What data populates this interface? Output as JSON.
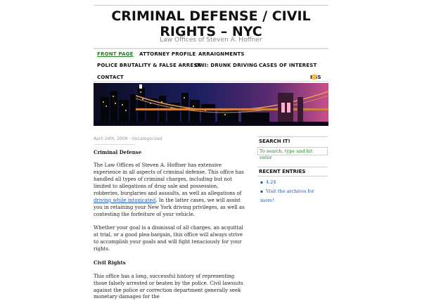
{
  "site": {
    "title": "CRIMINAL DEFENSE / CIVIL RIGHTS – NYC",
    "tagline": "Law Offices of Steven A. Hoffner"
  },
  "nav": {
    "items": [
      "FRONT PAGE",
      "ATTORNEY PROFILE",
      "ARRAIGNMENTS",
      "POLICE BRUTALITY & FALSE ARREST",
      "DWI: DRUNK DRIVING",
      "CASES OF INTEREST",
      "CONTACT"
    ],
    "rss": "RSS"
  },
  "post": {
    "meta": "April 24th, 2009 · Uncategorized",
    "heading1": "Criminal Defense",
    "p1_a": "The Law Offices of Steven A. Hoffner has extensive experience in all aspects of criminal defense. This office has handled all types of criminal charges, including but not limited to allegations of drug sale and possession, robberies, burglaries and assaults, as well as allegations of ",
    "p1_link": "driving while intoxicated",
    "p1_b": ".  In the latter cases,  we will assist you in retaining your New York driving privileges, as well as contesting the forfeiture of your vehicle.",
    "p2": "Whether your goal is a dismissal of all charges, an acquittal at trial, or a good plea-bargain, this office will always strive to accomplish your goals and will fight tenaciously for your rights.",
    "heading2": "Civil Rights",
    "p3": "This office has a long, successful history of representing those falsely arrested or beaten by the police.  Civil lawsuits against the police or correction department generally seek monetary damages for the"
  },
  "sidebar": {
    "search_title": "SEARCH IT!",
    "search_placeholder": "To search, type and hit enter",
    "recent_title": "RECENT ENTRIES",
    "recent_items": [
      "4.24",
      "Visit the archives for more!"
    ]
  },
  "colors": {
    "accent_green": "#2a7a2a",
    "link_blue": "#1a56b8",
    "rss_orange": "#f5b942"
  },
  "icons": {
    "rss": "rss-feed-icon"
  }
}
